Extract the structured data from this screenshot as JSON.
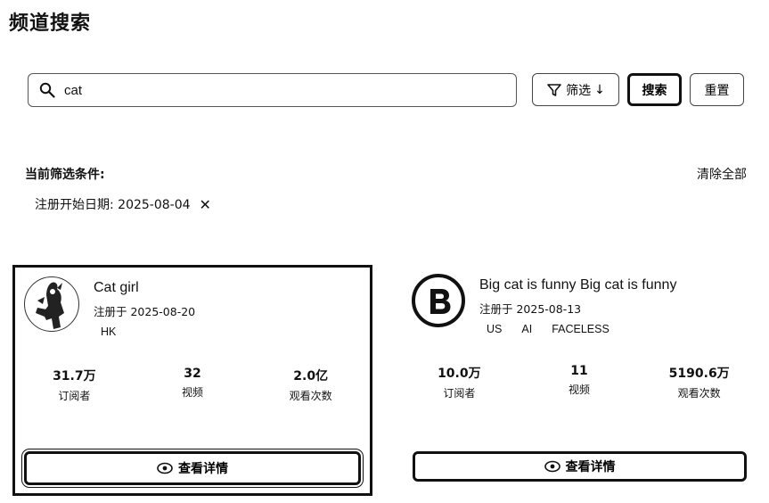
{
  "page": {
    "title": "频道搜索"
  },
  "search": {
    "value": "cat",
    "icon": "search-icon"
  },
  "toolbar": {
    "filter_label": "筛选",
    "filter_arrow": "↓",
    "search_label": "搜索",
    "reset_label": "重置"
  },
  "filters": {
    "title": "当前筛选条件:",
    "clear_all": "清除全部",
    "active": [
      {
        "label": "注册开始日期: 2025-08-04",
        "remove": "✕"
      }
    ]
  },
  "channels": [
    {
      "name": "Cat girl",
      "registered": "注册于 2025-08-20",
      "tags": [
        "HK"
      ],
      "stats": [
        {
          "value": "31.7万",
          "label": "订阅者"
        },
        {
          "value": "32",
          "label": "视频"
        },
        {
          "value": "2.0亿",
          "label": "观看次数"
        }
      ],
      "detail_label": "查看详情"
    },
    {
      "name": "Big cat is funny Big cat is funny",
      "registered": "注册于 2025-08-13",
      "tags": [
        "US",
        "AI",
        "FACELESS"
      ],
      "stats": [
        {
          "value": "10.0万",
          "label": "订阅者"
        },
        {
          "value": "11",
          "label": "视频"
        },
        {
          "value": "5190.6万",
          "label": "观看次数"
        }
      ],
      "detail_label": "查看详情"
    }
  ]
}
